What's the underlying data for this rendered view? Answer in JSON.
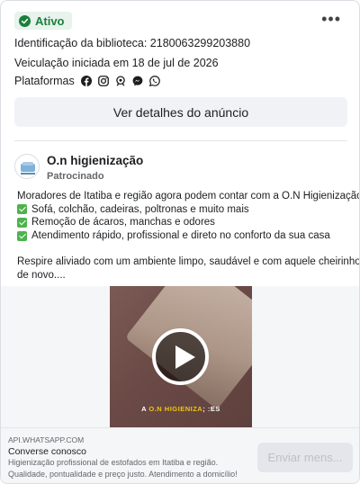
{
  "status": {
    "label": "Ativo",
    "color": "#1a7f3c",
    "icon": "check-circle-icon"
  },
  "more_menu": {
    "label": "•••",
    "icon": "more-options-icon"
  },
  "library_id": "Identificação da biblioteca: 2180063299203880",
  "delivery_started": "Veiculação iniciada em 18 de jul de 2026",
  "platforms": {
    "label": "Plataformas",
    "icons": [
      "facebook-icon",
      "instagram-icon",
      "audience-network-icon",
      "messenger-icon",
      "whatsapp-icon"
    ]
  },
  "details_button": "Ver detalhes do anúncio",
  "advertiser": {
    "name": "O.n higienização",
    "sponsored": "Patrocinado"
  },
  "body": {
    "intro": "Moradores de Itatiba e região agora podem contar com a O.N Higienização:",
    "bullets": [
      "Sofá, colchão, cadeiras, poltronas e muito mais",
      "Remoção de ácaros, manchas e odores",
      "Atendimento rápido, profissional e direto no conforto da sua casa"
    ],
    "outro_line1": "Respire aliviado com um ambiente limpo, saudável e com aquele cheirinho",
    "outro_line2": "de novo...."
  },
  "video": {
    "caption_prefix": "A ",
    "caption_highlight": "O.N HIGIENIZA",
    "caption_suffix": "; :ES"
  },
  "footer": {
    "domain": "API.WHATSAPP.COM",
    "title": "Converse conosco",
    "description": "Higienização profissional de estofados em Itatiba e região. Qualidade, pontualidade e preço justo. Atendimento a domicílio!",
    "cta": "Enviar mens..."
  }
}
